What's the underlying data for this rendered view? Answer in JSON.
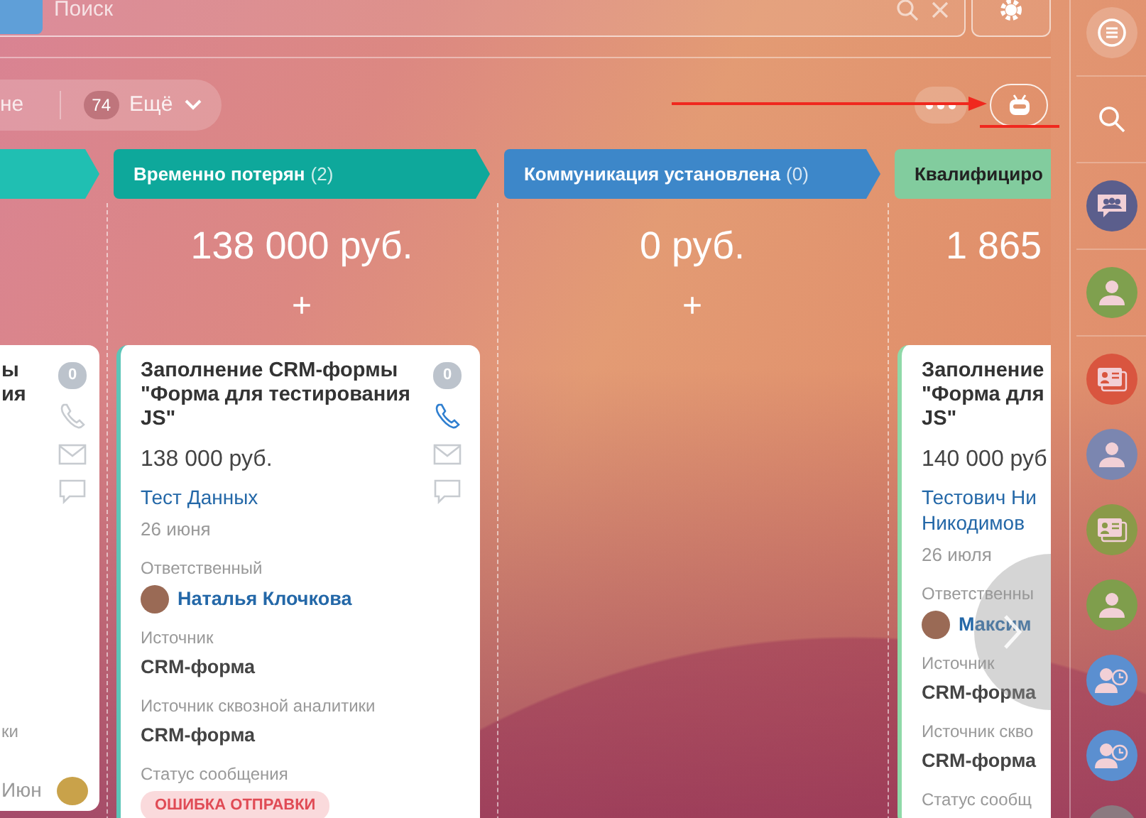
{
  "search": {
    "placeholder": "Поиск"
  },
  "filter": {
    "current": "не",
    "counter": "74",
    "more_label": "Ещё"
  },
  "stages": [
    {
      "kind": "clipped_left",
      "color": "#20bfb2",
      "cards": [
        {
          "title": "ы\nия",
          "activity_count": "0",
          "phone_active": false,
          "label_fragment": "ки",
          "date": "Июн"
        }
      ]
    },
    {
      "kind": "full",
      "title": "Временно потерян",
      "count": "(2)",
      "color": "#0ea89b",
      "sum": "138 000 руб.",
      "add_label": "+",
      "cards": [
        {
          "title": "Заполнение CRM-формы \"Форма для тестирования JS\"",
          "amount": "138 000 руб.",
          "contact": "Тест Данных",
          "date": "26 июня",
          "activity_count": "0",
          "phone_active": true,
          "fields": [
            {
              "kind": "user",
              "label": "Ответственный",
              "value": "Наталья Клочкова"
            },
            {
              "kind": "text",
              "label": "Источник",
              "value": "CRM-форма"
            },
            {
              "kind": "text",
              "label": "Источник сквозной аналитики",
              "value": "CRM-форма"
            },
            {
              "kind": "tag",
              "label": "Статус сообщения",
              "value": "ОШИБКА ОТПРАВКИ"
            }
          ]
        }
      ]
    },
    {
      "kind": "full",
      "title": "Коммуникация установлена",
      "count": "(0)",
      "color": "#3d87c9",
      "sum": "0 руб.",
      "add_label": "+"
    },
    {
      "kind": "clipped_right",
      "title": "Квалифициро",
      "color": "#82cc9e",
      "sum": "1 865",
      "cards": [
        {
          "title": "Заполнение\n\"Форма для\nJS\"",
          "amount": "140 000 руб",
          "contact": "Тестович Ни\nНикодимов",
          "date": "26 июля",
          "fields": [
            {
              "kind": "user",
              "label": "Ответственны",
              "value": "Максим"
            },
            {
              "kind": "text",
              "label": "Источник",
              "value": "CRM-форма"
            },
            {
              "kind": "text",
              "label": "Источник скво",
              "value": "CRM-форма"
            },
            {
              "label": "Статус сообщ"
            }
          ]
        }
      ]
    }
  ],
  "sidebar": [
    {
      "kind": "chat"
    },
    {
      "kind": "search"
    },
    {
      "kind": "group_chat",
      "color": "#5b5e8c"
    },
    {
      "kind": "person",
      "color": "#7fa04e"
    },
    {
      "kind": "contact_card",
      "color": "#d9553f"
    },
    {
      "kind": "person",
      "color": "#7b86b0"
    },
    {
      "kind": "contact_card",
      "color": "#8a9a48"
    },
    {
      "kind": "person",
      "color": "#7f9e4c"
    },
    {
      "kind": "person_clock",
      "color": "#5b8fd0"
    },
    {
      "kind": "person_clock",
      "color": "#5b8fd0"
    },
    {
      "kind": "avatar",
      "color": "#8a7a80"
    }
  ]
}
